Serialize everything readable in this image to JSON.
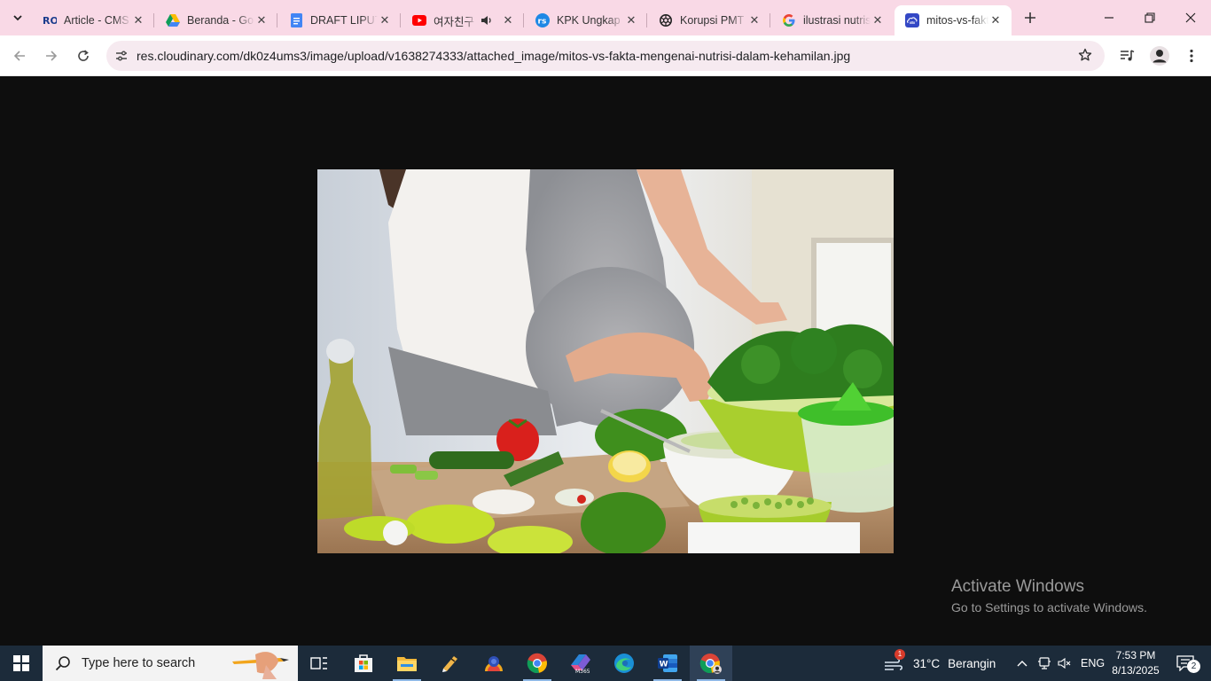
{
  "browser": {
    "tabs": [
      {
        "title": "Article - CMS",
        "favicon": "ro-logo-icon",
        "active": false
      },
      {
        "title": "Beranda - Google Drive",
        "favicon": "google-drive-icon",
        "active": false
      },
      {
        "title": "DRAFT LIPUTAN",
        "favicon": "google-docs-icon",
        "active": false
      },
      {
        "title": "여자친구",
        "favicon": "youtube-icon",
        "active": false,
        "audio": true
      },
      {
        "title": "KPK Ungkap",
        "favicon": "rs-icon",
        "active": false
      },
      {
        "title": "Korupsi PMT",
        "favicon": "chatgpt-icon",
        "active": false
      },
      {
        "title": "ilustrasi nutrisi",
        "favicon": "google-icon",
        "active": false
      },
      {
        "title": "mitos-vs-fakta",
        "favicon": "cloudinary-icon",
        "active": true
      }
    ],
    "url": "res.cloudinary.com/dk0z4ums3/image/upload/v1638274333/attached_image/mitos-vs-fakta-mengenai-nutrisi-dalam-kehamilan.jpg",
    "accent_color": "#f9d9e6"
  },
  "watermark": {
    "line1": "Activate Windows",
    "line2": "Go to Settings to activate Windows."
  },
  "taskbar": {
    "search_placeholder": "Type here to search",
    "weather": "31°C",
    "weather_label": "Berangin",
    "weather_badge": "1",
    "language": "ENG",
    "time": "7:53 PM",
    "date": "8/13/2025",
    "notifications": "2",
    "apps": [
      "task-view-icon",
      "microsoft-store-icon",
      "file-explorer-icon",
      "app-icon",
      "vpn-icon",
      "chrome-icon",
      "m365-icon",
      "edge-icon",
      "word-icon",
      "chrome-profile-icon"
    ]
  }
}
